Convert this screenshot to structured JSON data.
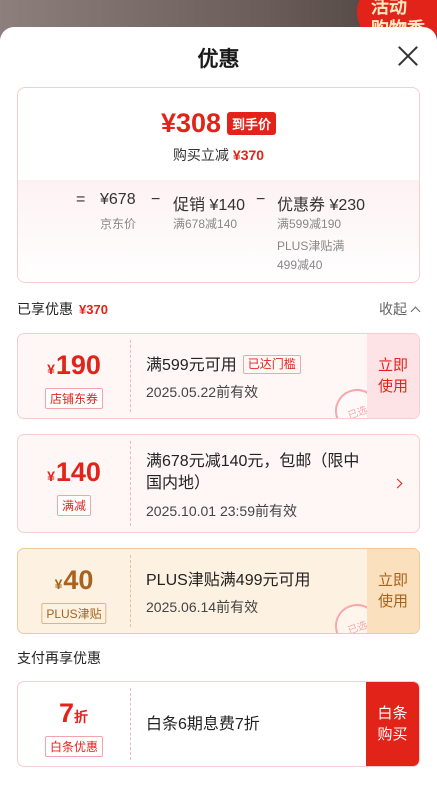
{
  "background": {
    "badge_text": "活动\n购物季"
  },
  "header": {
    "title": "优惠"
  },
  "summary": {
    "final_price": "¥308",
    "final_tag": "到手价",
    "reduce_label": "购买立减",
    "reduce_amount": "¥370",
    "breakdown": {
      "equals": "=",
      "base_price": "¥678",
      "base_label": "京东价",
      "minus1": "−",
      "promo_title": "促销 ¥140",
      "promo_detail": "满678减140",
      "minus2": "−",
      "coupon_title": "优惠券 ¥230",
      "coupon_detail_1": "满599减190",
      "coupon_detail_2": "PLUS津贴满",
      "coupon_detail_3": "499减40"
    }
  },
  "enjoyed": {
    "label": "已享优惠",
    "amount": "¥370",
    "collapse": "收起"
  },
  "coupons": [
    {
      "currency": "¥",
      "amount": "190",
      "label": "店铺东券",
      "main": "满599元可用",
      "reach_tag": "已达门槛",
      "sub": "2025.05.22前有效",
      "action": "立即\n使用",
      "stamp": "已选"
    },
    {
      "currency": "¥",
      "amount": "140",
      "label": "满减",
      "main_line1": "满678元减140元，包邮（限中",
      "main_line2": "国内地）",
      "sub": "2025.10.01 23:59前有效"
    },
    {
      "currency": "¥",
      "amount": "40",
      "label": "PLUS津贴",
      "main": "PLUS津贴满499元可用",
      "sub": "2025.06.14前有效",
      "action": "立即\n使用",
      "stamp": "已选"
    }
  ],
  "pay_section": {
    "label": "支付再享优惠",
    "discount": "7",
    "discount_unit": "折",
    "tag": "白条优惠",
    "main": "白条6期息费7折",
    "action": "白条\n购买"
  },
  "colors": {
    "accent": "#e2231a",
    "plus": "#a8621d"
  }
}
